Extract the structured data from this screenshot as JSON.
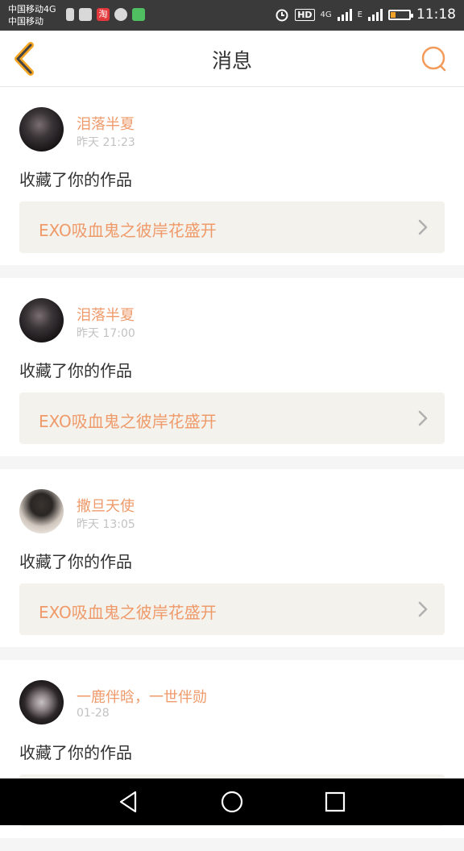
{
  "status_bar": {
    "carrier_line1": "中国移动4G",
    "carrier_line2": "中国移动",
    "taobao_label": "淘",
    "hd_label": "HD",
    "net_label_4g": "4G",
    "net_label_e": "E",
    "time": "11:18",
    "battery_level": 0.25,
    "colors": {
      "background": "#3a3a3a",
      "battery": "#f0a22b"
    }
  },
  "header": {
    "title": "消息",
    "back_icon": "chevron-left-icon",
    "search_icon": "search-icon",
    "accent_color": "#f5a623",
    "search_color": "#f39b5b"
  },
  "messages": [
    {
      "username": "泪落半夏",
      "time": "昨天 21:23",
      "action": "收藏了你的作品",
      "work_title": "EXO吸血鬼之彼岸花盛开"
    },
    {
      "username": "泪落半夏",
      "time": "昨天 17:00",
      "action": "收藏了你的作品",
      "work_title": "EXO吸血鬼之彼岸花盛开"
    },
    {
      "username": "撒旦天使",
      "time": "昨天 13:05",
      "action": "收藏了你的作品",
      "work_title": "EXO吸血鬼之彼岸花盛开"
    },
    {
      "username": "一鹿伴晗，一世伴勋",
      "time": "01-28",
      "action": "收藏了你的作品",
      "work_title": ""
    }
  ],
  "navbar": {
    "back": "triangle-back-icon",
    "home": "circle-home-icon",
    "recents": "square-recents-icon"
  }
}
